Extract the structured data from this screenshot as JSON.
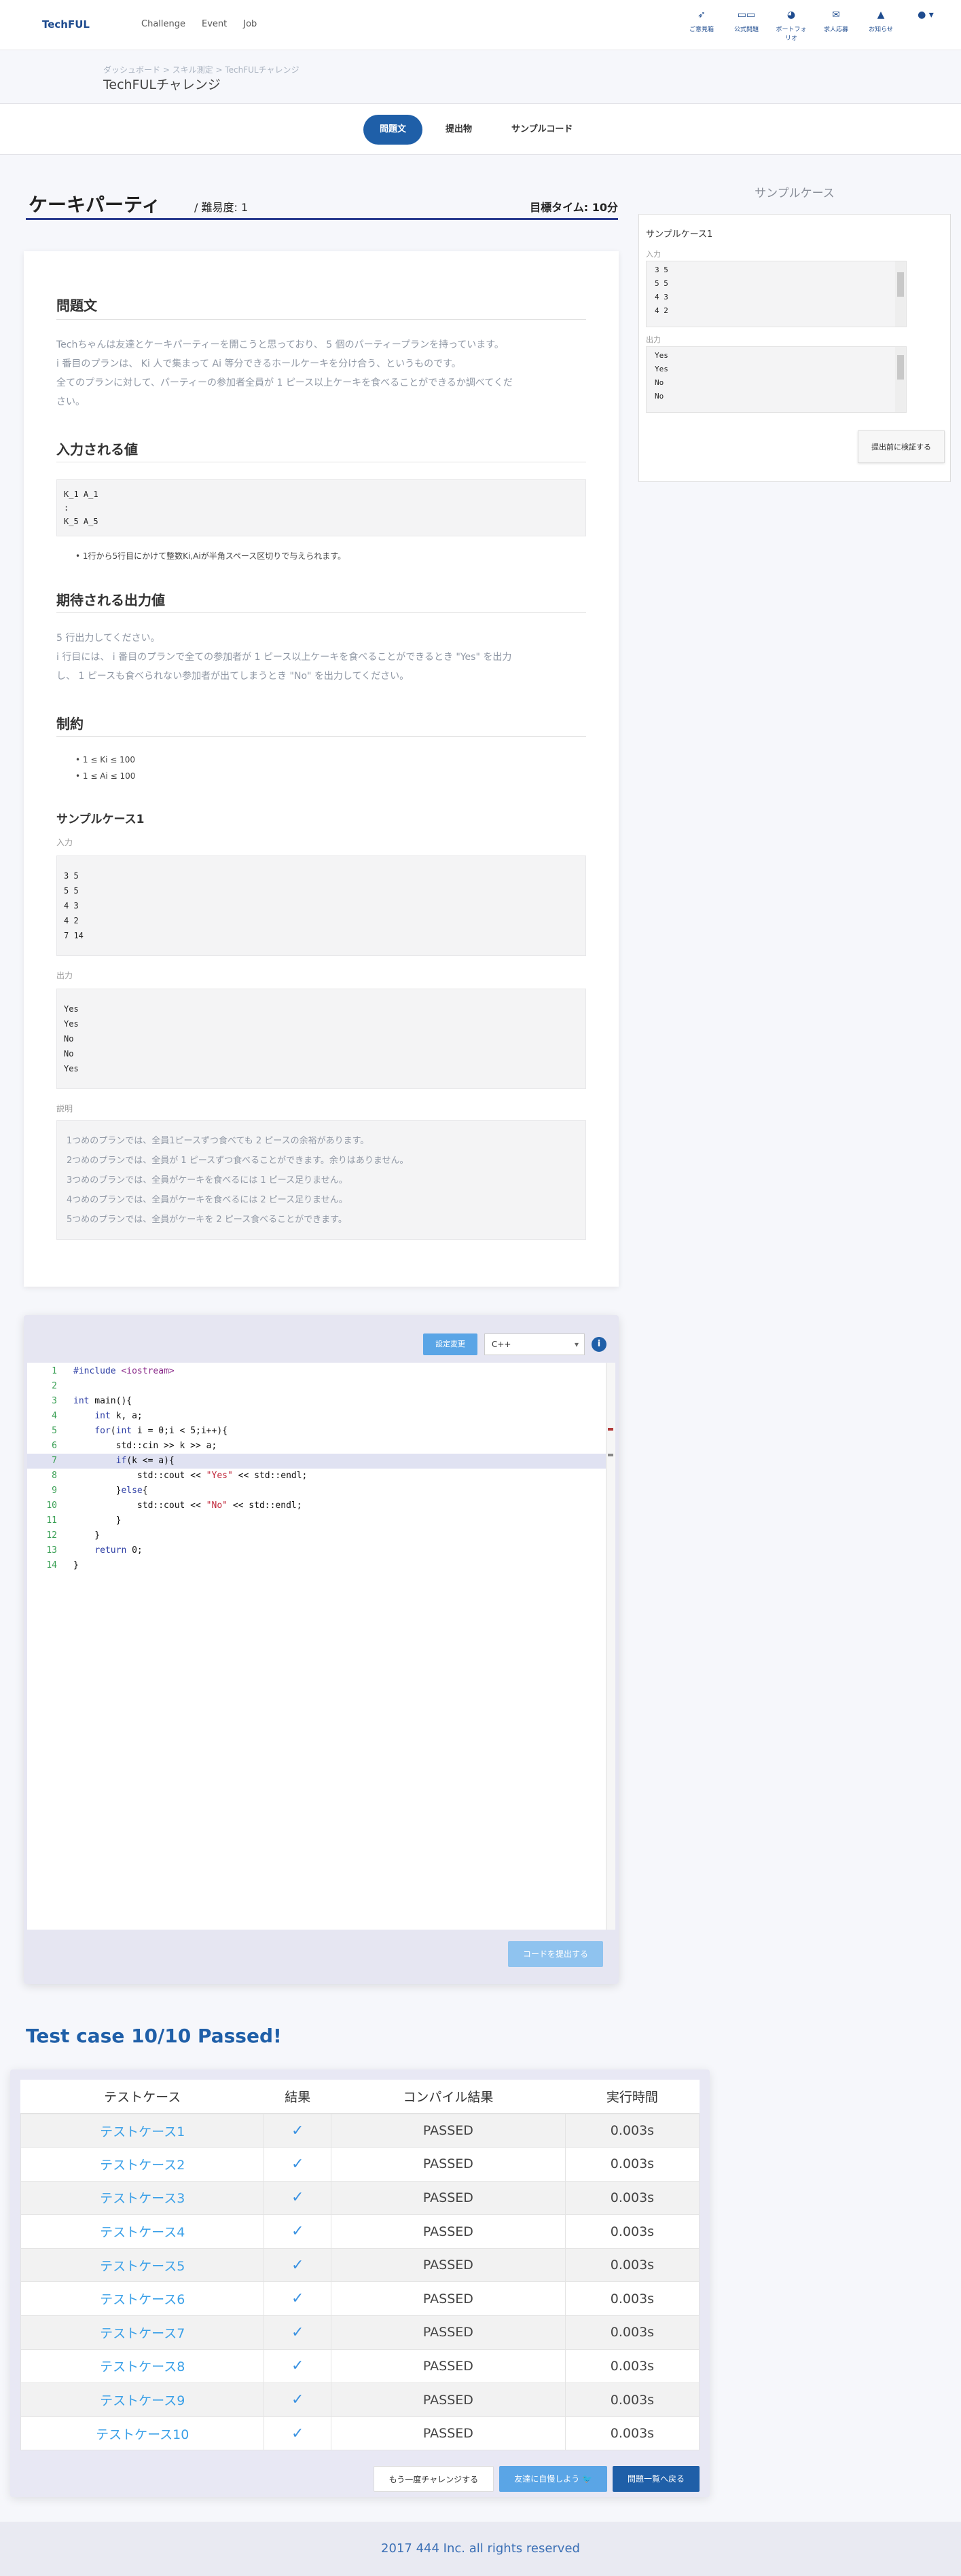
{
  "nav": {
    "brand": "TechFUL",
    "links": [
      "Challenge",
      "Event",
      "Job"
    ],
    "icons": [
      {
        "icon": "paper-plane-icon",
        "label": "ご意見箱"
      },
      {
        "icon": "book-icon",
        "label": "公式問題"
      },
      {
        "icon": "pie-chart-icon",
        "label": "ポートフォリオ"
      },
      {
        "icon": "mail-icon",
        "label": "求人応募"
      },
      {
        "icon": "bell-icon",
        "label": "お知らせ"
      },
      {
        "icon": "user-icon",
        "label": ""
      }
    ]
  },
  "header": {
    "breadcrumb": "ダッシュボード > スキル測定 > TechFULチャレンジ",
    "title": "TechFULチャレンジ"
  },
  "tabs": [
    "問題文",
    "提出物",
    "サンプルコード"
  ],
  "problem": {
    "title": "ケーキパーティ",
    "difficulty": "/ 難易度: 1",
    "time_limit": "目標タイム: 10分",
    "statement_heading": "問題文",
    "statement_lines": [
      "Techちゃんは友達とケーキパーティーを開こうと思っており、 5 個のパーティープランを持っています。",
      "i 番目のプランは、 Ki 人で集まって Ai 等分できるホールケーキを分け合う、というものです。",
      "全てのプランに対して、パーティーの参加者全員が 1 ピース以上ケーキを食べることができるか調べてくだ",
      "さい。"
    ],
    "input_heading": "入力される値",
    "input_format": [
      "K_1 A_1",
      ":",
      "K_5 A_5"
    ],
    "input_note": "1行から5行目にかけて整数Ki,Aiが半角スペース区切りで与えられます。",
    "output_heading": "期待される出力値",
    "output_lines": [
      "5 行出力してください。",
      "i 行目には、 i 番目のプランで全ての参加者が 1 ピース以上ケーキを食べることができるとき \"Yes\" を出力",
      "し、 1 ピースも食べられない参加者が出てしまうとき \"No\" を出力してください。"
    ],
    "constraints_heading": "制約",
    "constraints": [
      "1 ≤ Ki ≤ 100",
      "1 ≤ Ai ≤ 100"
    ],
    "sample_heading": "サンプルケース1",
    "sample_input_label": "入力",
    "sample_input": [
      "3 5",
      "5 5",
      "4 3",
      "4 2",
      "7 14"
    ],
    "sample_output_label": "出力",
    "sample_output": [
      "Yes",
      "Yes",
      "No",
      "No",
      "Yes"
    ],
    "explanation_label": "説明",
    "explanation": [
      "1つめのプランでは、全員1ピースずつ食べても 2 ピースの余裕があります。",
      "2つめのプランでは、全員が 1 ピースずつ食べることができます。余りはありません。",
      "3つめのプランでは、全員がケーキを食べるには 1 ピース足りません。",
      "4つめのプランでは、全員がケーキを食べるには 2 ピース足りません。",
      "5つめのプランでは、全員がケーキを 2 ピース食べることができます。"
    ]
  },
  "sidebar": {
    "heading": "サンプルケース",
    "case_title": "サンプルケース1",
    "input_label": "入力",
    "input_lines": [
      "3 5",
      "5 5",
      "4 3",
      "4 2"
    ],
    "output_label": "出力",
    "output_lines": [
      "Yes",
      "Yes",
      "No",
      "No"
    ],
    "verify_button": "提出前に検証する"
  },
  "editor": {
    "settings_button": "設定変更",
    "language": "C++",
    "submit_button": "コードを提出する",
    "code": [
      "#include <iostream>",
      "",
      "int main(){",
      "    int k, a;",
      "    for(int i = 0;i < 5;i++){",
      "        std::cin >> k >> a;",
      "        if(k <= a){",
      "            std::cout << \"Yes\" << std::endl;",
      "        }else{",
      "            std::cout << \"No\" << std::endl;",
      "        }",
      "    }",
      "    return 0;",
      "}"
    ],
    "highlighted_line": 7
  },
  "results": {
    "summary": "Test case 10/10 Passed!",
    "columns": [
      "テストケース",
      "結果",
      "コンパイル結果",
      "実行時間"
    ],
    "rows": [
      {
        "name": "テストケース1",
        "compile": "PASSED",
        "time": "0.003s"
      },
      {
        "name": "テストケース2",
        "compile": "PASSED",
        "time": "0.003s"
      },
      {
        "name": "テストケース3",
        "compile": "PASSED",
        "time": "0.003s"
      },
      {
        "name": "テストケース4",
        "compile": "PASSED",
        "time": "0.003s"
      },
      {
        "name": "テストケース5",
        "compile": "PASSED",
        "time": "0.003s"
      },
      {
        "name": "テストケース6",
        "compile": "PASSED",
        "time": "0.003s"
      },
      {
        "name": "テストケース7",
        "compile": "PASSED",
        "time": "0.003s"
      },
      {
        "name": "テストケース8",
        "compile": "PASSED",
        "time": "0.003s"
      },
      {
        "name": "テストケース9",
        "compile": "PASSED",
        "time": "0.003s"
      },
      {
        "name": "テストケース10",
        "compile": "PASSED",
        "time": "0.003s"
      }
    ],
    "retry_button": "もう一度チャレンジする",
    "share_button": "友達に自慢しよう",
    "back_button": "問題一覧へ戻る"
  },
  "footer": "2017 444 Inc. all rights reserved"
}
